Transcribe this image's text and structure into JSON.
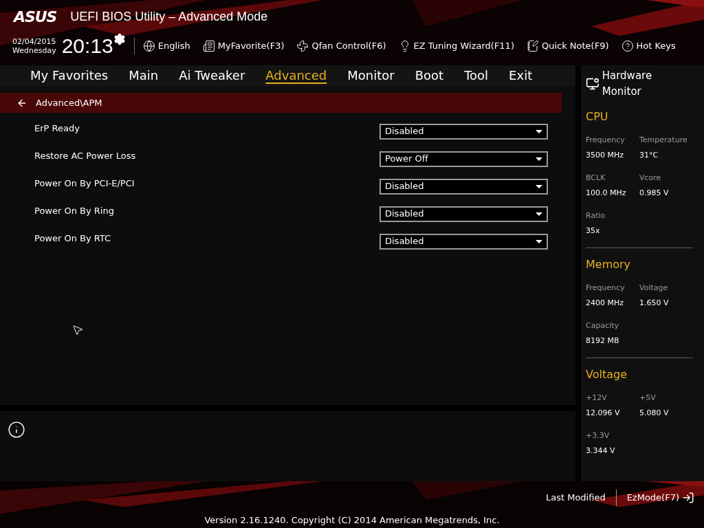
{
  "header": {
    "logo": "ASUS",
    "title": "UEFI BIOS Utility – Advanced Mode",
    "date": "02/04/2015",
    "weekday": "Wednesday",
    "time": "20:13",
    "tools": [
      {
        "kind": "globe",
        "label": "English"
      },
      {
        "kind": "favorite",
        "label": "MyFavorite(F3)"
      },
      {
        "kind": "fan",
        "label": "Qfan Control(F6)"
      },
      {
        "kind": "bulb",
        "label": "EZ Tuning Wizard(F11)"
      },
      {
        "kind": "note",
        "label": "Quick Note(F9)"
      },
      {
        "kind": "help",
        "label": "Hot Keys"
      }
    ]
  },
  "tabs": [
    {
      "label": "My Favorites",
      "selected": false
    },
    {
      "label": "Main",
      "selected": false
    },
    {
      "label": "Ai Tweaker",
      "selected": false
    },
    {
      "label": "Advanced",
      "selected": true
    },
    {
      "label": "Monitor",
      "selected": false
    },
    {
      "label": "Boot",
      "selected": false
    },
    {
      "label": "Tool",
      "selected": false
    },
    {
      "label": "Exit",
      "selected": false
    }
  ],
  "breadcrumb": "Advanced\\APM",
  "settings": [
    {
      "label": "ErP Ready",
      "value": "Disabled"
    },
    {
      "label": "Restore AC Power Loss",
      "value": "Power Off"
    },
    {
      "label": "Power On By PCI-E/PCI",
      "value": "Disabled"
    },
    {
      "label": "Power On By Ring",
      "value": "Disabled"
    },
    {
      "label": "Power On By RTC",
      "value": "Disabled"
    }
  ],
  "hardware_monitor": {
    "title": "Hardware Monitor",
    "sections": [
      {
        "title": "CPU",
        "items": [
          {
            "label": "Frequency",
            "value": "3500 MHz"
          },
          {
            "label": "Temperature",
            "value": "31°C"
          },
          {
            "label": "BCLK",
            "value": "100.0 MHz"
          },
          {
            "label": "Vcore",
            "value": "0.985 V"
          },
          {
            "label": "Ratio",
            "value": "35x"
          }
        ]
      },
      {
        "title": "Memory",
        "items": [
          {
            "label": "Frequency",
            "value": "2400 MHz"
          },
          {
            "label": "Voltage",
            "value": "1.650 V"
          },
          {
            "label": "Capacity",
            "value": "8192 MB"
          }
        ]
      },
      {
        "title": "Voltage",
        "items": [
          {
            "label": "+12V",
            "value": "12.096 V"
          },
          {
            "label": "+5V",
            "value": "5.080 V"
          },
          {
            "label": "+3.3V",
            "value": "3.344 V"
          }
        ]
      }
    ]
  },
  "footer": {
    "last_modified": "Last Modified",
    "ez_mode": "EzMode(F7)",
    "copyright": "Version 2.16.1240. Copyright (C) 2014 American Megatrends, Inc."
  }
}
